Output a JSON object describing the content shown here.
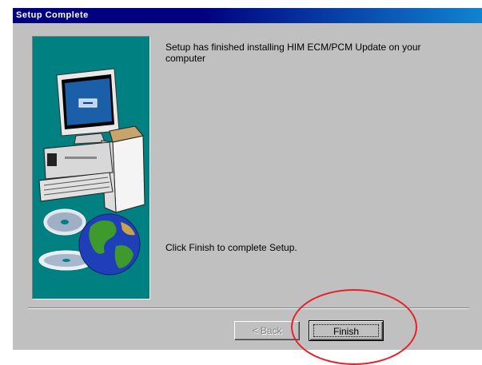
{
  "window": {
    "title": "Setup Complete"
  },
  "content": {
    "message_top": "Setup has finished installing HIM ECM/PCM Update on your computer",
    "message_bottom": "Click Finish to complete Setup."
  },
  "buttons": {
    "back_label": "< Back",
    "finish_label": "Finish"
  },
  "colors": {
    "titlebar": "#000080",
    "panel_bg": "#008080",
    "dialog_bg": "#c0c0c0",
    "annotation": "#e8202a"
  },
  "icons": [
    "computer-icon",
    "cd-disc-icon",
    "globe-icon"
  ]
}
